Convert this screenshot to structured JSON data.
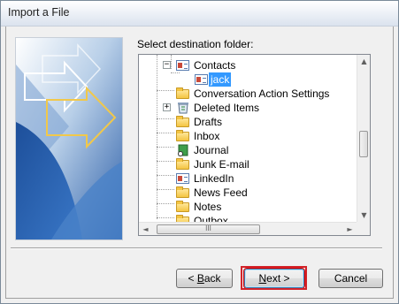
{
  "window": {
    "title": "Import a File"
  },
  "prompt": {
    "text_before": "Select destination folder",
    "text_accel": "",
    "text_after": ":"
  },
  "tree": {
    "items": [
      {
        "label": "Contacts",
        "icon": "contacts-card-icon",
        "expander": "−"
      },
      {
        "label": "jack",
        "icon": "contacts-card-icon",
        "selected": true
      },
      {
        "label": "Conversation Action Settings",
        "icon": "folder-icon"
      },
      {
        "label": "Deleted Items",
        "icon": "deleted-items-icon",
        "expander": "+"
      },
      {
        "label": "Drafts",
        "icon": "drafts-folder-icon"
      },
      {
        "label": "Inbox",
        "icon": "inbox-folder-icon"
      },
      {
        "label": "Journal",
        "icon": "journal-icon"
      },
      {
        "label": "Junk E-mail",
        "icon": "junk-folder-icon"
      },
      {
        "label": "LinkedIn",
        "icon": "contacts-card-icon"
      },
      {
        "label": "News Feed",
        "icon": "folder-icon"
      },
      {
        "label": "Notes",
        "icon": "notes-folder-icon"
      },
      {
        "label": "Outbox",
        "icon": "outbox-folder-icon"
      }
    ],
    "scroll_up": "▲",
    "scroll_down": "▼",
    "scroll_left": "◄",
    "scroll_right": "►",
    "hscroll_grip": "III"
  },
  "buttons": {
    "back": {
      "prefix": "< ",
      "accel": "B",
      "rest": "ack"
    },
    "next": {
      "prefix": "",
      "accel": "N",
      "rest": "ext >"
    },
    "cancel": {
      "label": "Cancel"
    }
  },
  "colors": {
    "selection": "#3399ff",
    "highlight_frame": "#d2232a"
  }
}
